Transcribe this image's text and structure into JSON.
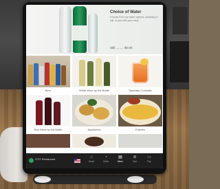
{
  "hero": {
    "title": "Choice of Water",
    "description": "Choose from our water options, sparkling or still, to pair with your meal.",
    "price": "Still ......... $0.00"
  },
  "categories": [
    {
      "caption": "Beer"
    },
    {
      "caption": "White Wine by the Bottle"
    },
    {
      "caption": "Specialty Cocktails"
    },
    {
      "caption": "Red Wine by the Bottle"
    },
    {
      "caption": "Appetizers"
    },
    {
      "caption": "Entrees"
    }
  ],
  "tabbar": {
    "logo_text": "OTG Restaurant",
    "tabs": [
      {
        "icon": "home-icon",
        "label": "Home"
      },
      {
        "icon": "clock-icon",
        "label": "Order"
      },
      {
        "icon": "menu-icon",
        "label": "Menu"
      },
      {
        "icon": "cart-icon",
        "label": "Cart"
      },
      {
        "icon": "pay-icon",
        "label": "Pay"
      }
    ]
  },
  "colors": {
    "tabbar": "#1f1f1f",
    "accent": "#2f9e5a",
    "hero_bg": "#f4f4f2"
  }
}
